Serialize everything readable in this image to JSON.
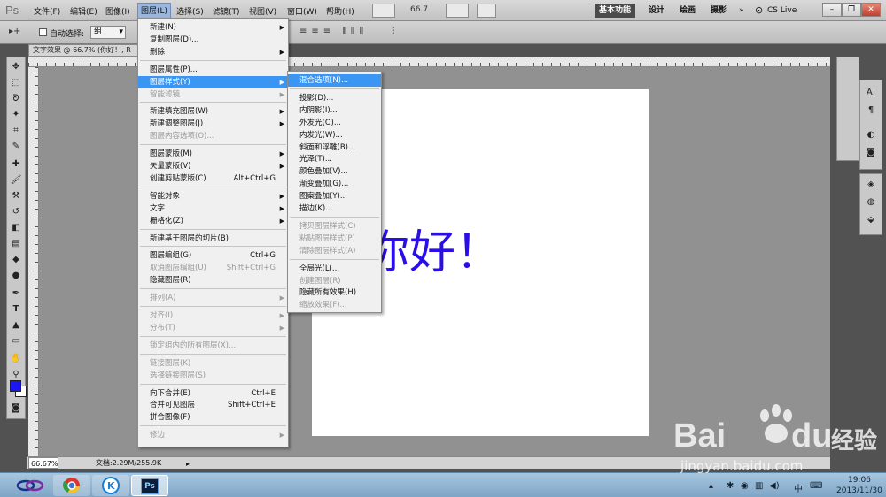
{
  "app_logo": "Ps",
  "menubar": {
    "items": [
      "文件(F)",
      "编辑(E)",
      "图像(I)",
      "图层(L)",
      "选择(S)",
      "滤镜(T)",
      "视图(V)",
      "窗口(W)",
      "帮助(H)"
    ],
    "zoom": "66.7",
    "workspaces": [
      "基本功能",
      "设计",
      "绘画",
      "摄影"
    ],
    "cslive": "CS Live"
  },
  "optbar": {
    "auto_select_label": "自动选择:",
    "auto_select_value": "组"
  },
  "document": {
    "tab_title": "文字效果 @ 66.7% (你好！, R",
    "canvas_text": "你好！",
    "zoom_status": "66.67%",
    "doc_size": "文档:2.29M/255.9K"
  },
  "layer_menu": [
    {
      "label": "新建(N)",
      "sub": true
    },
    {
      "label": "复制图层(D)..."
    },
    {
      "label": "删除",
      "sub": true
    },
    {
      "sep": true
    },
    {
      "label": "图层属性(P)..."
    },
    {
      "label": "图层样式(Y)",
      "sub": true,
      "hl": true
    },
    {
      "label": "智能滤镜",
      "sub": true,
      "dis": true
    },
    {
      "sep": true
    },
    {
      "label": "新建填充图层(W)",
      "sub": true
    },
    {
      "label": "新建调整图层(J)",
      "sub": true
    },
    {
      "label": "图层内容选项(O)...",
      "dis": true
    },
    {
      "sep": true
    },
    {
      "label": "图层蒙版(M)",
      "sub": true
    },
    {
      "label": "矢量蒙版(V)",
      "sub": true
    },
    {
      "label": "创建剪贴蒙版(C)",
      "sc": "Alt+Ctrl+G"
    },
    {
      "sep": true
    },
    {
      "label": "智能对象",
      "sub": true
    },
    {
      "label": "文字",
      "sub": true
    },
    {
      "label": "栅格化(Z)",
      "sub": true
    },
    {
      "sep": true
    },
    {
      "label": "新建基于图层的切片(B)"
    },
    {
      "sep": true
    },
    {
      "label": "图层编组(G)",
      "sc": "Ctrl+G"
    },
    {
      "label": "取消图层编组(U)",
      "sc": "Shift+Ctrl+G",
      "dis": true
    },
    {
      "label": "隐藏图层(R)"
    },
    {
      "sep": true
    },
    {
      "label": "排列(A)",
      "sub": true,
      "dis": true
    },
    {
      "sep": true
    },
    {
      "label": "对齐(I)",
      "sub": true,
      "dis": true
    },
    {
      "label": "分布(T)",
      "sub": true,
      "dis": true
    },
    {
      "sep": true
    },
    {
      "label": "锁定组内的所有图层(X)...",
      "dis": true
    },
    {
      "sep": true
    },
    {
      "label": "链接图层(K)",
      "dis": true
    },
    {
      "label": "选择链接图层(S)",
      "dis": true
    },
    {
      "sep": true
    },
    {
      "label": "向下合并(E)",
      "sc": "Ctrl+E"
    },
    {
      "label": "合并可见图层",
      "sc": "Shift+Ctrl+E"
    },
    {
      "label": "拼合图像(F)"
    },
    {
      "sep": true
    },
    {
      "label": "修边",
      "sub": true,
      "dis": true
    }
  ],
  "style_submenu": [
    {
      "label": "混合选项(N)...",
      "hl": true
    },
    {
      "sep": true
    },
    {
      "label": "投影(D)..."
    },
    {
      "label": "内阴影(I)..."
    },
    {
      "label": "外发光(O)..."
    },
    {
      "label": "内发光(W)..."
    },
    {
      "label": "斜面和浮雕(B)..."
    },
    {
      "label": "光泽(T)..."
    },
    {
      "label": "颜色叠加(V)..."
    },
    {
      "label": "渐变叠加(G)..."
    },
    {
      "label": "图案叠加(Y)..."
    },
    {
      "label": "描边(K)..."
    },
    {
      "sep": true
    },
    {
      "label": "拷贝图层样式(C)",
      "dis": true
    },
    {
      "label": "粘贴图层样式(P)",
      "dis": true
    },
    {
      "label": "清除图层样式(A)",
      "dis": true
    },
    {
      "sep": true
    },
    {
      "label": "全局光(L)..."
    },
    {
      "label": "创建图层(R)",
      "dis": true
    },
    {
      "label": "隐藏所有效果(H)"
    },
    {
      "label": "缩放效果(F)...",
      "dis": true
    }
  ],
  "taskbar": {
    "clock_time": "19:06",
    "clock_date": "2013/11/30",
    "ime": "中",
    "ps_label": "Ps"
  },
  "watermark": {
    "brand": "Bai",
    "brand2": "du",
    "brand_cn": "经验",
    "url": "jingyan.baidu.com"
  },
  "colors": {
    "foreground": "#1c16f0",
    "text_blue": "#2a0ee8",
    "menu_highlight": "#3b95f2"
  }
}
